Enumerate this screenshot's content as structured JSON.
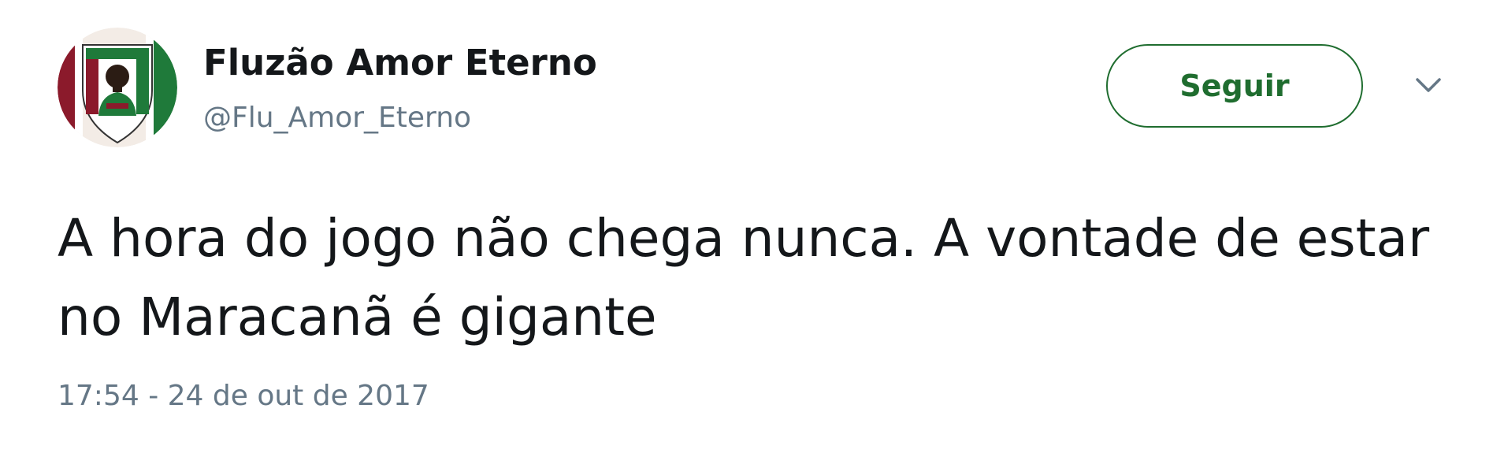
{
  "author": {
    "display_name": "Fluzão Amor Eterno",
    "handle": "@Flu_Amor_Eterno",
    "avatar_icon": "fluminense-crest-avatar"
  },
  "actions": {
    "follow_label": "Seguir",
    "menu_icon": "chevron-down-icon"
  },
  "tweet": {
    "text": "A hora do jogo não chega nunca. A vontade de estar no Maracanã é gigante",
    "timestamp": "17:54 - 24 de out de 2017"
  },
  "colors": {
    "follow_accent": "#1f6d2f",
    "secondary_text": "#657786",
    "primary_text": "#14171a",
    "crest_red": "#8b1a2b",
    "crest_green": "#1f7a3a"
  }
}
